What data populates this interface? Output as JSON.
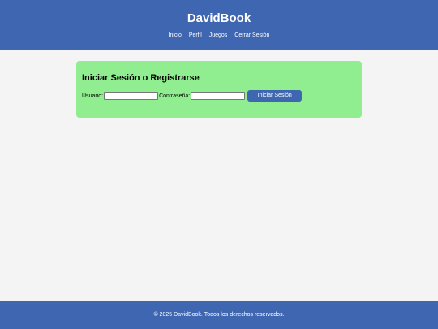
{
  "header": {
    "title": "DavidBook",
    "nav": [
      {
        "label": "Inicio"
      },
      {
        "label": "Perfil"
      },
      {
        "label": "Juegos"
      },
      {
        "label": "Cerrar Sesión"
      }
    ]
  },
  "login": {
    "title": "Iniciar Sesión o Registrarse",
    "username_label": "Usuario:",
    "username_value": "",
    "password_label": "Contraseña:",
    "password_value": "",
    "submit_label": "Iniciar Sesión"
  },
  "footer": {
    "text": "© 2025 DavidBook. Todos los derechos reservados."
  },
  "colors": {
    "header_bg": "#3f66b1",
    "card_bg": "#90ee90",
    "page_bg": "#f4f4f4",
    "button_bg": "#3f66b1"
  }
}
